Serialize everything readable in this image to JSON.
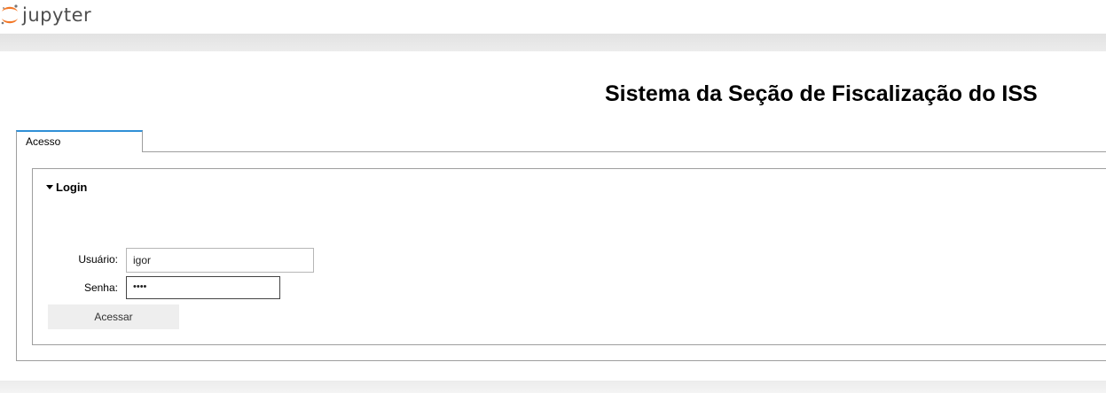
{
  "header": {
    "logo_text": "jupyter",
    "logo_icon": "jupyter-logo-icon",
    "accent_color": "#f37726"
  },
  "page": {
    "title": "Sistema da Seção de Fiscalização do ISS"
  },
  "tabs": [
    {
      "label": "Acesso",
      "active": true
    }
  ],
  "login": {
    "legend": "Login",
    "legend_icon": "caret-down-icon",
    "username_label": "Usuário:",
    "username_value": "igor",
    "password_label": "Senha:",
    "password_value": "••••",
    "submit_label": "Acessar"
  }
}
